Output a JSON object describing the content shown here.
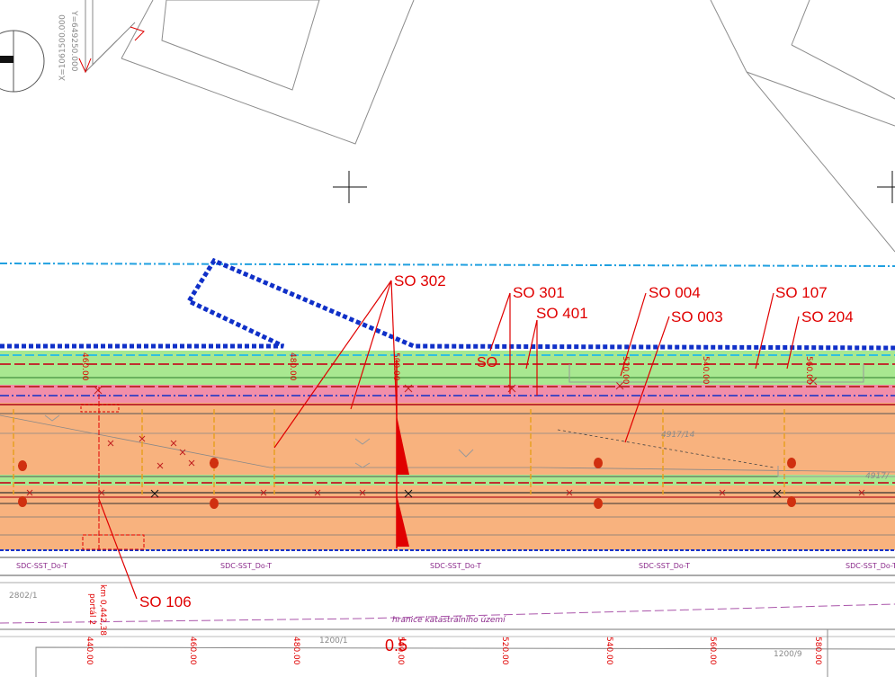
{
  "coords": {
    "y": "Y=649250.000",
    "x": "X=1061500.000"
  },
  "callouts": [
    "SO 302",
    "SO 301",
    "SO 401",
    "SO 004",
    "SO 003",
    "SO 107",
    "SO 204",
    "SO 106"
  ],
  "inner_label": "SO",
  "chainage": {
    "top": [
      "460.00",
      "480.00",
      "500.00",
      "520.00",
      "540.00",
      "560.00"
    ],
    "bottom": [
      "440.00",
      "460.00",
      "480.00",
      "500.00",
      "520.00",
      "540.00",
      "560.00",
      "580.00"
    ],
    "km_note": "km 0,442,38",
    "km_note2": "portál 2"
  },
  "parcels": {
    "p1": "4917/14",
    "p2": "4917/",
    "p3": "2802/1",
    "p4": "1200/1",
    "p5": "1200/9",
    "boundary": "hranice katastrálního území"
  },
  "cable_tag": "SDC-SST_Do-T",
  "scale_marker": "0.5",
  "colors": {
    "orange": "#f8b27e",
    "green": "#a8e890",
    "pink": "#f07a9a",
    "red": "#e00000",
    "blue": "#1030c8",
    "cyan": "#20b8e0"
  }
}
